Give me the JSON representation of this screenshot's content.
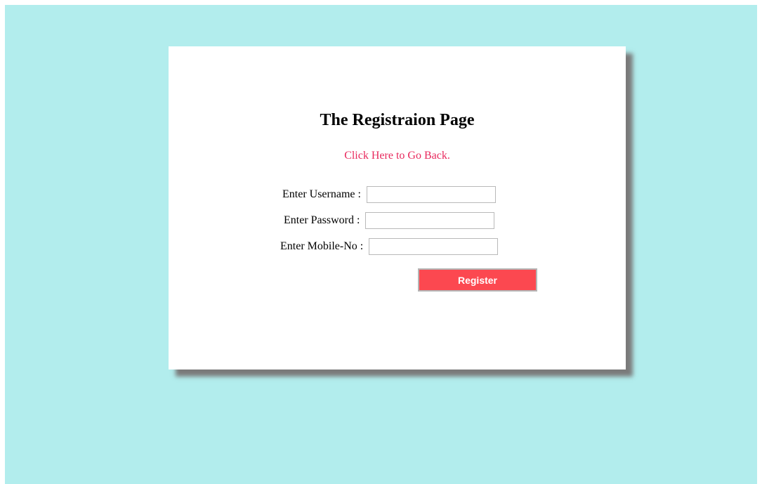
{
  "form": {
    "title": "The Registraion Page",
    "back_link": "Click Here to Go Back.",
    "fields": [
      {
        "label": "Enter Username :",
        "value": ""
      },
      {
        "label": "Enter Password :",
        "value": ""
      },
      {
        "label": "Enter Mobile-No :",
        "value": ""
      }
    ],
    "register_label": "Register"
  },
  "colors": {
    "page_background": "#b2eded",
    "card_background": "#ffffff",
    "link": "#e8295d",
    "button": "#fc4850"
  }
}
